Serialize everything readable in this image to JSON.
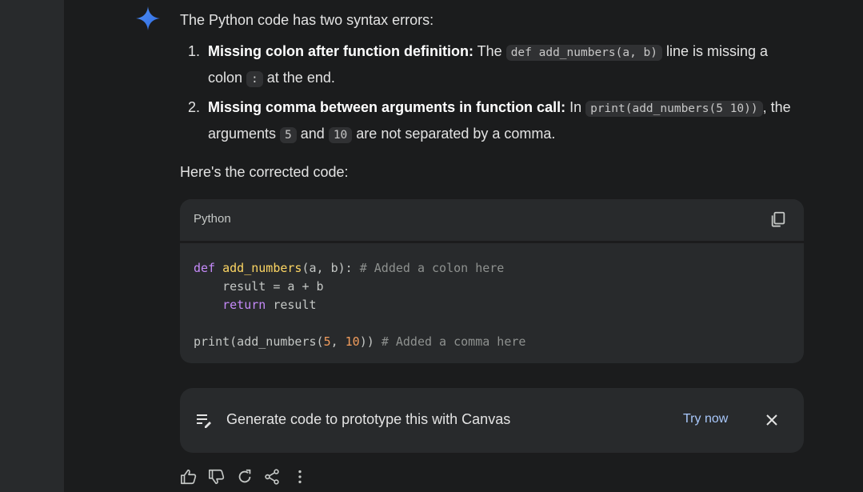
{
  "response": {
    "intro": "The Python code has two syntax errors:",
    "errors": [
      {
        "number": "1.",
        "title": "Missing colon after function definition:",
        "text_a": " The ",
        "code_a": "def add_numbers(a, b)",
        "text_b": " line is missing a colon ",
        "code_b": ":",
        "text_c": " at the end."
      },
      {
        "number": "2.",
        "title": "Missing comma between arguments in function call:",
        "text_a": " In ",
        "code_a": "print(add_numbers(5 10))",
        "text_b": ", the arguments ",
        "code_b": "5",
        "text_c": " and ",
        "code_c": "10",
        "text_d": " are not separated by a comma."
      }
    ],
    "corrected_intro": "Here's the corrected code:"
  },
  "code_block": {
    "language": "Python",
    "lines": {
      "l1_kw": "def",
      "l1_fn": "add_numbers",
      "l1_rest": "(a, b): ",
      "l1_comment": "# Added a colon here",
      "l2": "    result = a + b",
      "l3_indent": "    ",
      "l3_kw": "return",
      "l3_rest": " result",
      "l5_a": "print(add_numbers(",
      "l5_n1": "5",
      "l5_b": ", ",
      "l5_n2": "10",
      "l5_c": ")) ",
      "l5_comment": "# Added a comma here"
    }
  },
  "canvas_card": {
    "text": "Generate code to prototype this with Canvas",
    "cta": "Try now"
  },
  "icons": {
    "gem": "sparkle-icon",
    "copy": "copy-icon",
    "canvas": "canvas-edit-icon",
    "close": "close-icon",
    "actions": [
      "thumbs-up-icon",
      "thumbs-down-icon",
      "refresh-icon",
      "share-icon",
      "more-vert-icon"
    ]
  },
  "colors": {
    "background": "#1b1c1d",
    "rail": "#282a2c",
    "keyword": "#c58af9",
    "function": "#fdd663",
    "number": "#f29d5d",
    "comment": "#8e918f",
    "link": "#a8c7fa"
  }
}
